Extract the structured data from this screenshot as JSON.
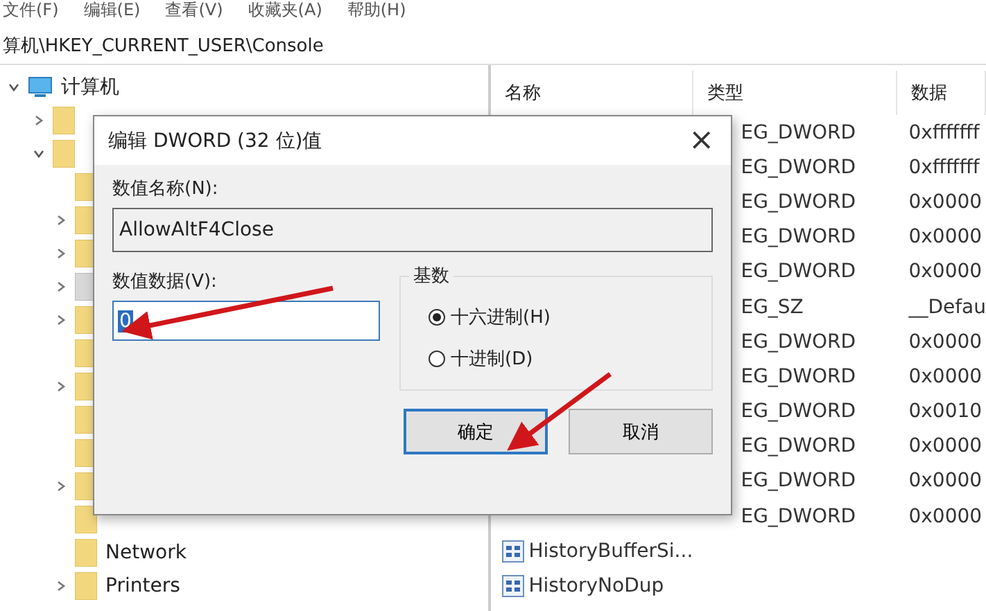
{
  "menu": [
    "文件(F)",
    "编辑(E)",
    "查看(V)",
    "收藏夹(A)",
    "帮助(H)"
  ],
  "address": "算机\\HKEY_CURRENT_USER\\Console",
  "tree": {
    "root": {
      "label": "计算机",
      "expanded": true
    },
    "hives": [
      {
        "expanded": false
      },
      {
        "expanded": true
      }
    ],
    "keys": [
      {
        "has_children": false,
        "selected": false
      },
      {
        "has_children": true,
        "selected": false
      },
      {
        "has_children": true,
        "selected": false
      },
      {
        "has_children": true,
        "selected": true
      },
      {
        "has_children": true,
        "selected": false
      },
      {
        "has_children": false,
        "selected": false
      },
      {
        "has_children": true,
        "selected": false
      },
      {
        "has_children": false,
        "selected": false
      },
      {
        "has_children": false,
        "selected": false
      },
      {
        "has_children": true,
        "selected": false
      },
      {
        "has_children": false,
        "selected": false
      },
      {
        "label": "Network",
        "has_children": false,
        "selected": false
      },
      {
        "label": "Printers",
        "has_children": true,
        "selected": false
      }
    ]
  },
  "table": {
    "columns": [
      "名称",
      "类型",
      "数据"
    ],
    "rows": [
      {
        "type": "EG_DWORD",
        "data": "0xfffffff"
      },
      {
        "type": "EG_DWORD",
        "data": "0xfffffff"
      },
      {
        "type": "EG_DWORD",
        "data": "0x0000"
      },
      {
        "type": "EG_DWORD",
        "data": "0x0000"
      },
      {
        "type": "EG_DWORD",
        "data": "0x0000"
      },
      {
        "type": "EG_SZ",
        "data": "__Defau"
      },
      {
        "type": "EG_DWORD",
        "data": "0x0000"
      },
      {
        "type": "EG_DWORD",
        "data": "0x0000"
      },
      {
        "type": "EG_DWORD",
        "data": "0x0010"
      },
      {
        "type": "EG_DWORD",
        "data": "0x0000"
      },
      {
        "type": "EG_DWORD",
        "data": "0x0000"
      },
      {
        "type": "EG_DWORD",
        "data": "0x0000"
      },
      {
        "name": "HistoryBufferSi..."
      },
      {
        "name": "HistoryNoDup"
      }
    ]
  },
  "dialog": {
    "title": "编辑 DWORD (32 位)值",
    "close": "×",
    "name_label": "数值名称(N):",
    "name_value": "AllowAltF4Close",
    "data_label": "数值数据(V):",
    "data_value": "0",
    "radix": {
      "title": "基数",
      "options": [
        {
          "label": "十六进制(H)",
          "selected": true
        },
        {
          "label": "十进制(D)",
          "selected": false
        }
      ]
    },
    "buttons": [
      {
        "label": "确定",
        "default": true
      },
      {
        "label": "取消",
        "default": false
      }
    ]
  }
}
